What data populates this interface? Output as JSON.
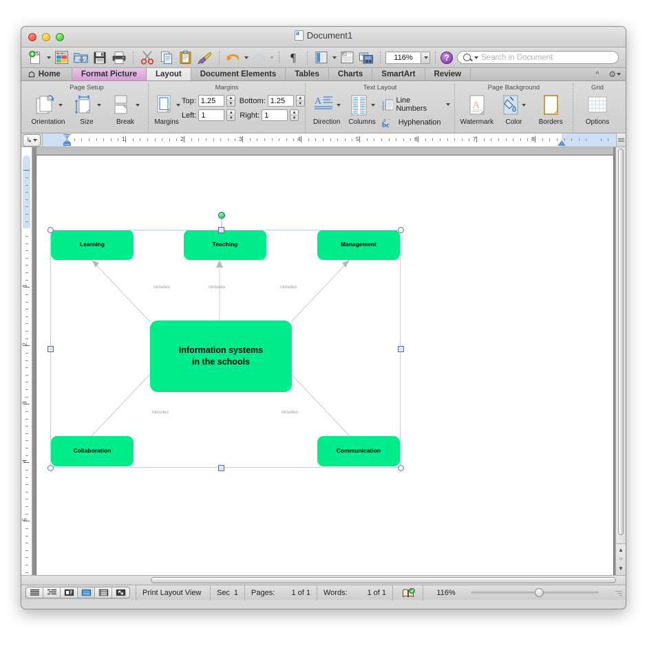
{
  "window": {
    "title": "Document1",
    "traffic_lights": [
      "close",
      "minimize",
      "zoom"
    ]
  },
  "toolbar": {
    "items": [
      {
        "name": "new-document",
        "label": "New"
      },
      {
        "name": "open-template-gallery",
        "label": "Template Gallery"
      },
      {
        "name": "open-document",
        "label": "Open"
      },
      {
        "name": "save-document",
        "label": "Save"
      },
      {
        "name": "print-document",
        "label": "Print"
      },
      {
        "name": "cut",
        "label": "Cut"
      },
      {
        "name": "copy",
        "label": "Copy"
      },
      {
        "name": "paste",
        "label": "Paste"
      },
      {
        "name": "format-painter",
        "label": "Format"
      },
      {
        "name": "undo",
        "label": "Undo"
      },
      {
        "name": "redo",
        "label": "Redo"
      },
      {
        "name": "show-formatting-marks",
        "label": "¶"
      },
      {
        "name": "sidebar-toggle",
        "label": "Sidebar"
      },
      {
        "name": "notebook-layout",
        "label": "Notebook"
      },
      {
        "name": "media-browser",
        "label": "Media"
      }
    ],
    "zoom_value": "116%",
    "help_label": "?",
    "search_placeholder": "Search in Document"
  },
  "tabs": [
    {
      "label": "Home",
      "state": "normal",
      "icon": "home-icon"
    },
    {
      "label": "Format Picture",
      "state": "contextual"
    },
    {
      "label": "Layout",
      "state": "active"
    },
    {
      "label": "Document Elements",
      "state": "normal"
    },
    {
      "label": "Tables",
      "state": "normal"
    },
    {
      "label": "Charts",
      "state": "normal"
    },
    {
      "label": "SmartArt",
      "state": "normal"
    },
    {
      "label": "Review",
      "state": "normal"
    }
  ],
  "ribbon": {
    "groups": [
      {
        "title": "Page Setup",
        "items": [
          {
            "label": "Orientation",
            "icon": "orientation-icon"
          },
          {
            "label": "Size",
            "icon": "page-size-icon"
          },
          {
            "label": "Break",
            "icon": "page-break-icon"
          }
        ]
      },
      {
        "title": "Margins",
        "items": [
          {
            "label": "Margins",
            "icon": "margins-icon"
          }
        ],
        "fields": [
          {
            "label": "Top:",
            "value": "1.25"
          },
          {
            "label": "Bottom:",
            "value": "1.25"
          },
          {
            "label": "Left:",
            "value": "1"
          },
          {
            "label": "Right:",
            "value": "1"
          }
        ]
      },
      {
        "title": "Text Layout",
        "items": [
          {
            "label": "Direction",
            "icon": "text-direction-icon"
          },
          {
            "label": "Columns",
            "icon": "columns-icon"
          }
        ],
        "buttons": [
          {
            "label": "Line Numbers",
            "icon": "line-numbers-icon"
          },
          {
            "label": "Hyphenation",
            "icon": "hyphenation-icon"
          }
        ]
      },
      {
        "title": "Page Background",
        "items": [
          {
            "label": "Watermark",
            "icon": "watermark-icon"
          },
          {
            "label": "Color",
            "icon": "page-color-icon"
          },
          {
            "label": "Borders",
            "icon": "page-borders-icon"
          }
        ]
      },
      {
        "title": "Grid",
        "items": [
          {
            "label": "Options",
            "icon": "grid-options-icon"
          }
        ]
      }
    ]
  },
  "ruler": {
    "horizontal_numbers": [
      "1",
      "2",
      "3",
      "4",
      "5",
      "6",
      "7",
      "8"
    ],
    "vertical_numbers": [
      "1",
      "2",
      "3",
      "4",
      "5"
    ]
  },
  "diagram": {
    "nodes": [
      {
        "id": "learning",
        "label": "Learning"
      },
      {
        "id": "teaching",
        "label": "Teaching"
      },
      {
        "id": "management",
        "label": "Management"
      },
      {
        "id": "center",
        "label": "Information systems\nin the schools"
      },
      {
        "id": "collaboration",
        "label": "Collaboration"
      },
      {
        "id": "communication",
        "label": "Communication"
      }
    ],
    "edge_label": "includes",
    "edge_labels": [
      "includes",
      "includes",
      "includes",
      "includes",
      "includes"
    ],
    "node_fill": "#00eb8c",
    "node_text_color": "#0a0a0a",
    "edge_color": "#cccccc",
    "selection_border_color": "#b9d4ec"
  },
  "statusbar": {
    "view_buttons": [
      {
        "name": "draft-view",
        "active": false
      },
      {
        "name": "outline-view",
        "active": false
      },
      {
        "name": "publishing-layout-view",
        "active": false
      },
      {
        "name": "print-layout-view",
        "active": true
      },
      {
        "name": "notebook-layout-view",
        "active": false
      },
      {
        "name": "full-screen-view",
        "active": false
      }
    ],
    "view_name": "Print Layout View",
    "sec_label": "Sec",
    "sec_value": "1",
    "pages_label": "Pages:",
    "pages_value": "1 of 1",
    "words_label": "Words:",
    "words_value": "1 of 1",
    "spelling_icon": "spelling-check-icon",
    "zoom_value": "116%"
  }
}
